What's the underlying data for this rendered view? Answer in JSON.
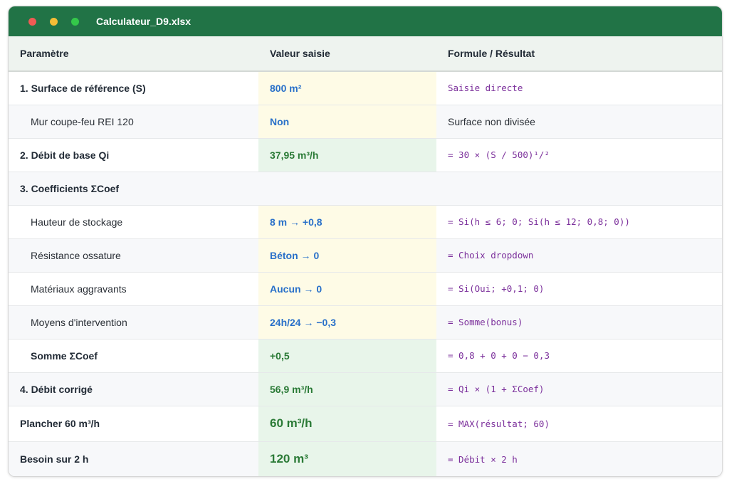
{
  "window": {
    "title": "Calculateur_D9.xlsx"
  },
  "headers": [
    "Paramètre",
    "Valeur saisie",
    "Formule / Résultat"
  ],
  "rows": [
    {
      "param": "1. Surface de référence (S)",
      "value": "800 m²",
      "formula": "Saisie directe"
    },
    {
      "param": "Mur coupe-feu REI 120",
      "value": "Non",
      "formula": "Surface non divisée"
    },
    {
      "param": "2. Débit de base Qi",
      "value": "37,95 m³/h",
      "formula": "= 30 × (S / 500)¹/²"
    },
    {
      "param": "3. Coefficients ΣCoef",
      "value": "",
      "formula": ""
    },
    {
      "param": "Hauteur de stockage",
      "value": "8 m → +0,8",
      "formula": "= Si(h ≤ 6; 0; Si(h ≤ 12; 0,8; 0))"
    },
    {
      "param": "Résistance ossature",
      "value": "Béton → 0",
      "formula": "= Choix dropdown"
    },
    {
      "param": "Matériaux aggravants",
      "value": "Aucun → 0",
      "formula": "= Si(Oui; +0,1; 0)"
    },
    {
      "param": "Moyens d'intervention",
      "value": "24h/24 → −0,3",
      "formula": "= Somme(bonus)"
    },
    {
      "param": "Somme ΣCoef",
      "value": "+0,5",
      "formula": "= 0,8 + 0 + 0 − 0,3"
    },
    {
      "param": "4. Débit corrigé",
      "value": "56,9 m³/h",
      "formula": "= Qi × (1 + ΣCoef)"
    },
    {
      "param": "Plancher 60 m³/h",
      "value": "60 m³/h",
      "formula": "= MAX(résultat; 60)"
    },
    {
      "param": "Besoin sur 2 h",
      "value": "120 m³",
      "formula": "= Débit × 2 h"
    }
  ],
  "colors": {
    "titlebar": "#217346",
    "input_value": "#2970c9",
    "computed_value": "#2a7a36",
    "formula_text": "#7b2f9b",
    "input_cell_bg": "#fefbe6",
    "computed_cell_bg": "#e8f5ea"
  }
}
